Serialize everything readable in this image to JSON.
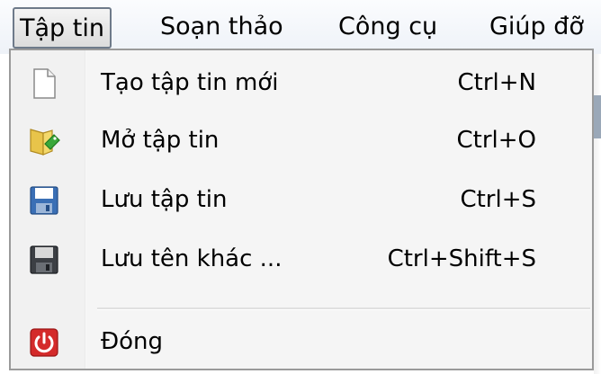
{
  "menubar": {
    "items": [
      {
        "label": "Tập tin",
        "active": true
      },
      {
        "label": "Soạn thảo",
        "active": false
      },
      {
        "label": "Công cụ",
        "active": false
      },
      {
        "label": "Giúp đỡ",
        "active": false
      }
    ]
  },
  "file_menu": {
    "items": [
      {
        "label": "Tạo tập tin mới",
        "shortcut": "Ctrl+N",
        "icon": "new-file-icon"
      },
      {
        "label": "Mở tập tin",
        "shortcut": "Ctrl+O",
        "icon": "open-folder-icon"
      },
      {
        "label": "Lưu tập tin",
        "shortcut": "Ctrl+S",
        "icon": "save-icon"
      },
      {
        "label": "Lưu tên khác ...",
        "shortcut": "Ctrl+Shift+S",
        "icon": "save-as-icon"
      },
      {
        "label": "Đóng",
        "shortcut": "",
        "icon": "power-icon"
      }
    ]
  },
  "colors": {
    "menu_background": "#f5f5f5",
    "menu_border": "#9a9a9a",
    "power_icon_red": "#d42a2a",
    "save_icon_blue": "#3a6fb5",
    "folder_yellow": "#e8c44a",
    "folder_green": "#3aa83a"
  }
}
